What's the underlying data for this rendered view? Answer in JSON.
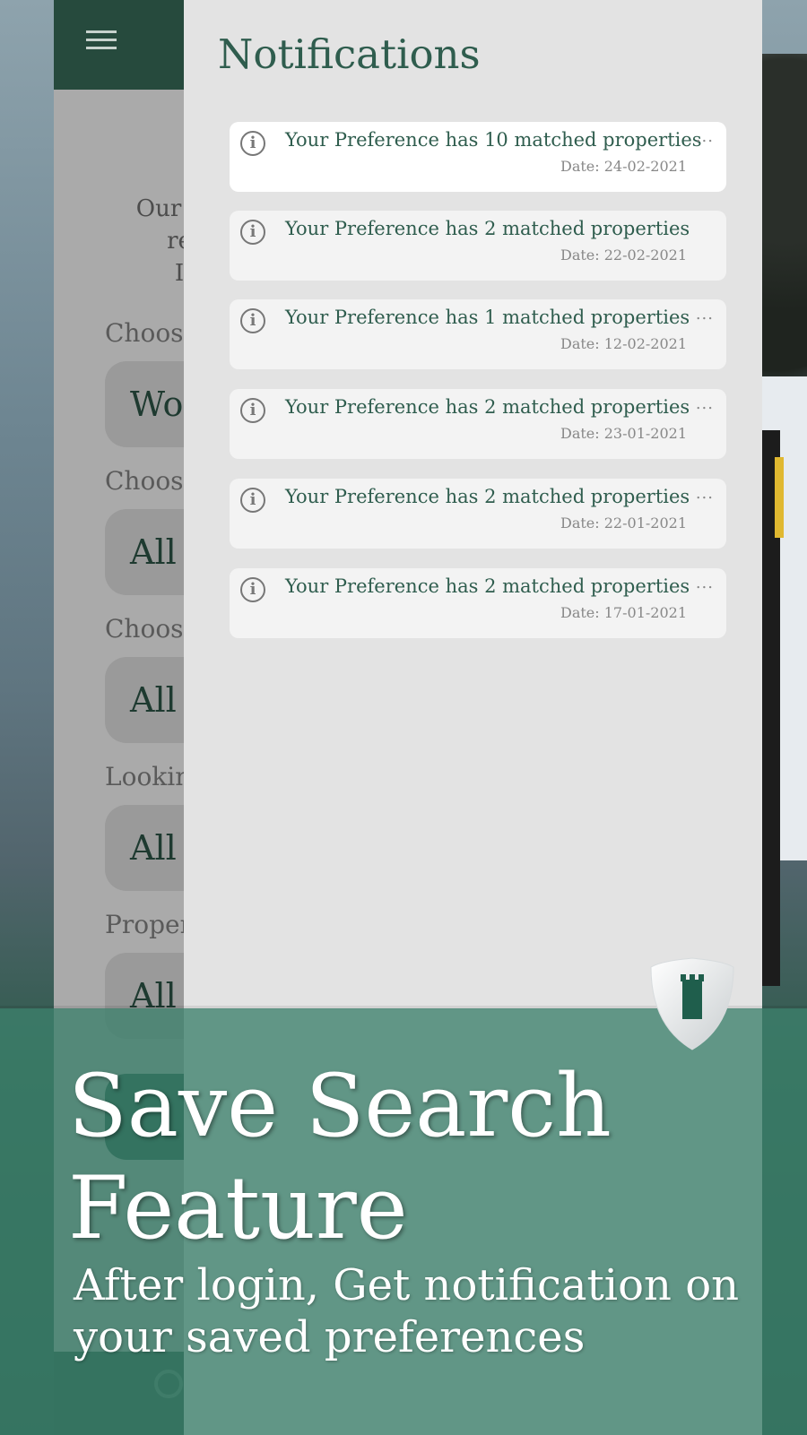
{
  "app": {
    "intro_text": "Our we\nre\nI",
    "fields": [
      {
        "label": "Choose",
        "value": "Wor"
      },
      {
        "label": "Choose",
        "value": "All"
      },
      {
        "label": "Choose",
        "value": "All"
      },
      {
        "label": "Lookin",
        "value": "All"
      },
      {
        "label": "Proper",
        "value": "All"
      }
    ]
  },
  "notifications": {
    "title": "Notifications",
    "items": [
      {
        "message": "Your Preference has 10 matched properties",
        "date": "Date: 24-02-2021",
        "more": "..."
      },
      {
        "message": "Your Preference has 2 matched properties",
        "date": "Date: 22-02-2021",
        "more": ""
      },
      {
        "message": "Your Preference has 1 matched properties",
        "date": "Date: 12-02-2021",
        "more": "..."
      },
      {
        "message": "Your Preference has 2 matched properties",
        "date": "Date: 23-01-2021",
        "more": "..."
      },
      {
        "message": "Your Preference has 2 matched properties",
        "date": "Date: 22-01-2021",
        "more": "..."
      },
      {
        "message": "Your Preference has 2 matched properties",
        "date": "Date: 17-01-2021",
        "more": "..."
      }
    ]
  },
  "banner": {
    "title": "Save Search Feature",
    "subtitle": "After login, Get notification on your saved preferences"
  },
  "icons": {
    "menu": "hamburger-icon",
    "info": "info-icon",
    "search": "search-icon",
    "logo": "shield-tower-logo"
  },
  "colors": {
    "brand_dark_green": "#264a3d",
    "text_green": "#2f5d4e",
    "banner_green": "#3c806c"
  }
}
